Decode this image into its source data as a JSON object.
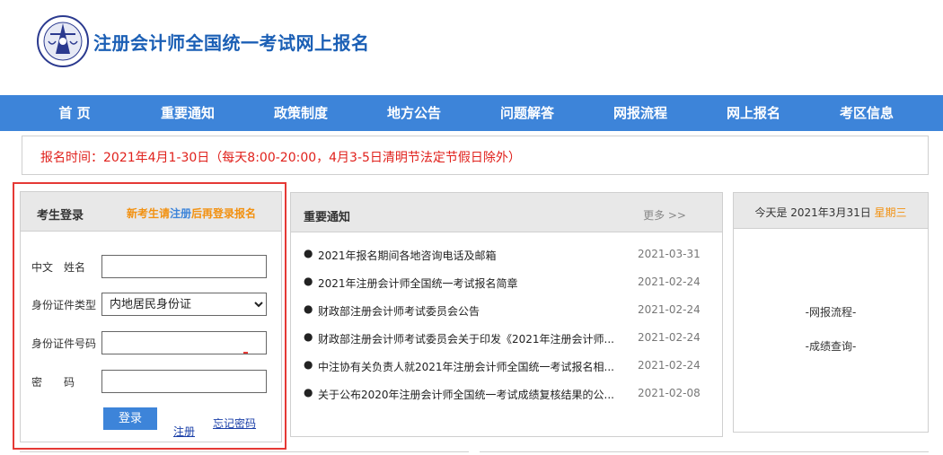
{
  "header": {
    "title": "注册会计师全国统一考试网上报名"
  },
  "nav": [
    "首 页",
    "重要通知",
    "政策制度",
    "地方公告",
    "问题解答",
    "网报流程",
    "网上报名",
    "考区信息"
  ],
  "notice": "报名时间：2021年4月1-30日（每天8:00-20:00，4月3-5日清明节法定节假日除外）",
  "login": {
    "title": "考生登录",
    "hint_prefix": "新考生请",
    "hint_link": "注册",
    "hint_suffix": "后再登录报名",
    "name_label": "中文　姓名",
    "idtype_label": "身份证件类型",
    "idtype_value": "内地居民身份证",
    "idnum_label": "身份证件号码",
    "password_label": "密　　码",
    "login_button": "登录",
    "register_link": "注册",
    "forgot_link": "忘记密码"
  },
  "news": {
    "title": "重要通知",
    "more": "更多 >>",
    "items": [
      {
        "title": "2021年报名期间各地咨询电话及邮箱",
        "date": "2021-03-31"
      },
      {
        "title": "2021年注册会计师全国统一考试报名简章",
        "date": "2021-02-24"
      },
      {
        "title": "财政部注册会计师考试委员会公告",
        "date": "2021-02-24"
      },
      {
        "title": "财政部注册会计师考试委员会关于印发《2021年注册会计师...",
        "date": "2021-02-24"
      },
      {
        "title": "中注协有关负责人就2021年注册会计师全国统一考试报名相...",
        "date": "2021-02-24"
      },
      {
        "title": "关于公布2020年注册会计师全国统一考试成绩复核结果的公...",
        "date": "2021-02-08"
      }
    ]
  },
  "today": {
    "prefix": "今天是 2021年3月31日 ",
    "weekday": "星期三",
    "link1": "-网报流程-",
    "link2": "-成绩查询-"
  }
}
